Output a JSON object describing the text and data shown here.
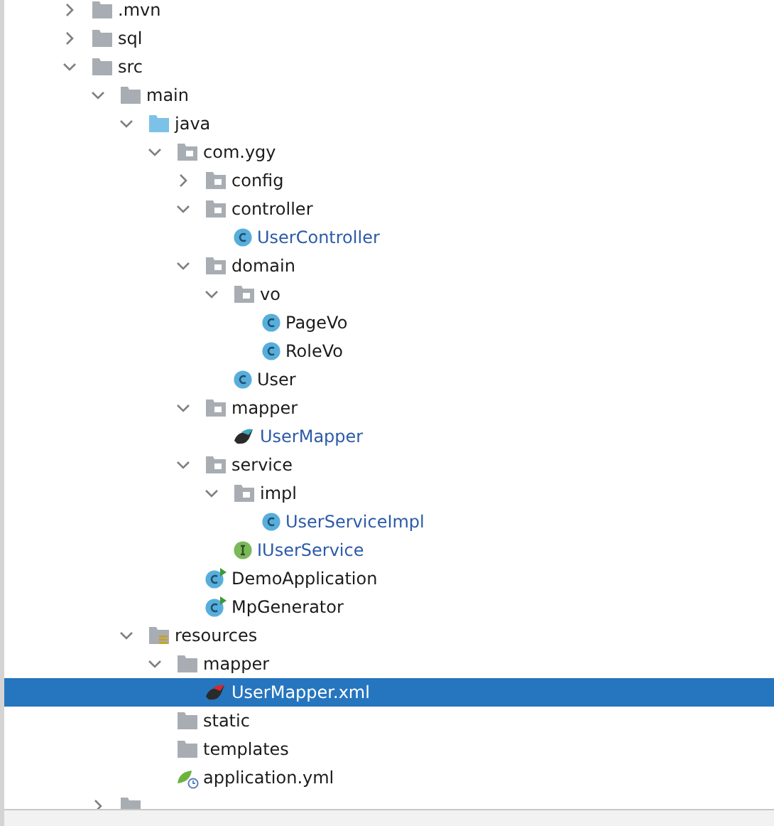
{
  "project_tree": {
    "items": [
      {
        "name": ".mvn",
        "kind": "folder",
        "expanded": false,
        "changed": false,
        "selected": false
      },
      {
        "name": "sql",
        "kind": "folder",
        "expanded": false,
        "changed": false,
        "selected": false
      },
      {
        "name": "src",
        "kind": "folder",
        "expanded": true,
        "changed": false,
        "selected": false,
        "children": [
          {
            "name": "main",
            "kind": "folder",
            "expanded": true,
            "changed": false,
            "selected": false,
            "children": [
              {
                "name": "java",
                "kind": "source-folder",
                "expanded": true,
                "changed": false,
                "selected": false,
                "children": [
                  {
                    "name": "com.ygy",
                    "kind": "package",
                    "expanded": true,
                    "changed": false,
                    "selected": false,
                    "children": [
                      {
                        "name": "config",
                        "kind": "package",
                        "expanded": false,
                        "changed": false,
                        "selected": false
                      },
                      {
                        "name": "controller",
                        "kind": "package",
                        "expanded": true,
                        "changed": false,
                        "selected": false,
                        "children": [
                          {
                            "name": "UserController",
                            "kind": "class",
                            "changed": true,
                            "selected": false
                          }
                        ]
                      },
                      {
                        "name": "domain",
                        "kind": "package",
                        "expanded": true,
                        "changed": false,
                        "selected": false,
                        "children": [
                          {
                            "name": "vo",
                            "kind": "package",
                            "expanded": true,
                            "changed": false,
                            "selected": false,
                            "children": [
                              {
                                "name": "PageVo",
                                "kind": "class",
                                "changed": false,
                                "selected": false
                              },
                              {
                                "name": "RoleVo",
                                "kind": "class",
                                "changed": false,
                                "selected": false
                              }
                            ]
                          },
                          {
                            "name": "User",
                            "kind": "class",
                            "changed": false,
                            "selected": false
                          }
                        ]
                      },
                      {
                        "name": "mapper",
                        "kind": "package",
                        "expanded": true,
                        "changed": false,
                        "selected": false,
                        "children": [
                          {
                            "name": "UserMapper",
                            "kind": "mapper",
                            "changed": true,
                            "selected": false
                          }
                        ]
                      },
                      {
                        "name": "service",
                        "kind": "package",
                        "expanded": true,
                        "changed": false,
                        "selected": false,
                        "children": [
                          {
                            "name": "impl",
                            "kind": "package",
                            "expanded": true,
                            "changed": false,
                            "selected": false,
                            "children": [
                              {
                                "name": "UserServiceImpl",
                                "kind": "class",
                                "changed": true,
                                "selected": false
                              }
                            ]
                          },
                          {
                            "name": "IUserService",
                            "kind": "interface",
                            "changed": true,
                            "selected": false
                          }
                        ]
                      },
                      {
                        "name": "DemoApplication",
                        "kind": "app-class",
                        "changed": false,
                        "selected": false
                      },
                      {
                        "name": "MpGenerator",
                        "kind": "app-class",
                        "changed": false,
                        "selected": false
                      }
                    ]
                  }
                ]
              },
              {
                "name": "resources",
                "kind": "resources-folder",
                "expanded": true,
                "changed": false,
                "selected": false,
                "children": [
                  {
                    "name": "mapper",
                    "kind": "folder",
                    "expanded": true,
                    "changed": false,
                    "selected": false,
                    "children": [
                      {
                        "name": "UserMapper.xml",
                        "kind": "mapper-xml",
                        "selected": true
                      }
                    ]
                  },
                  {
                    "name": "static",
                    "kind": "folder",
                    "changed": false,
                    "selected": false
                  },
                  {
                    "name": "templates",
                    "kind": "folder",
                    "changed": false,
                    "selected": false
                  },
                  {
                    "name": "application.yml",
                    "kind": "yml",
                    "changed": false,
                    "selected": false
                  }
                ]
              }
            ]
          },
          {
            "kind": "folder",
            "expanded": false,
            "selected": false
          }
        ]
      }
    ]
  }
}
